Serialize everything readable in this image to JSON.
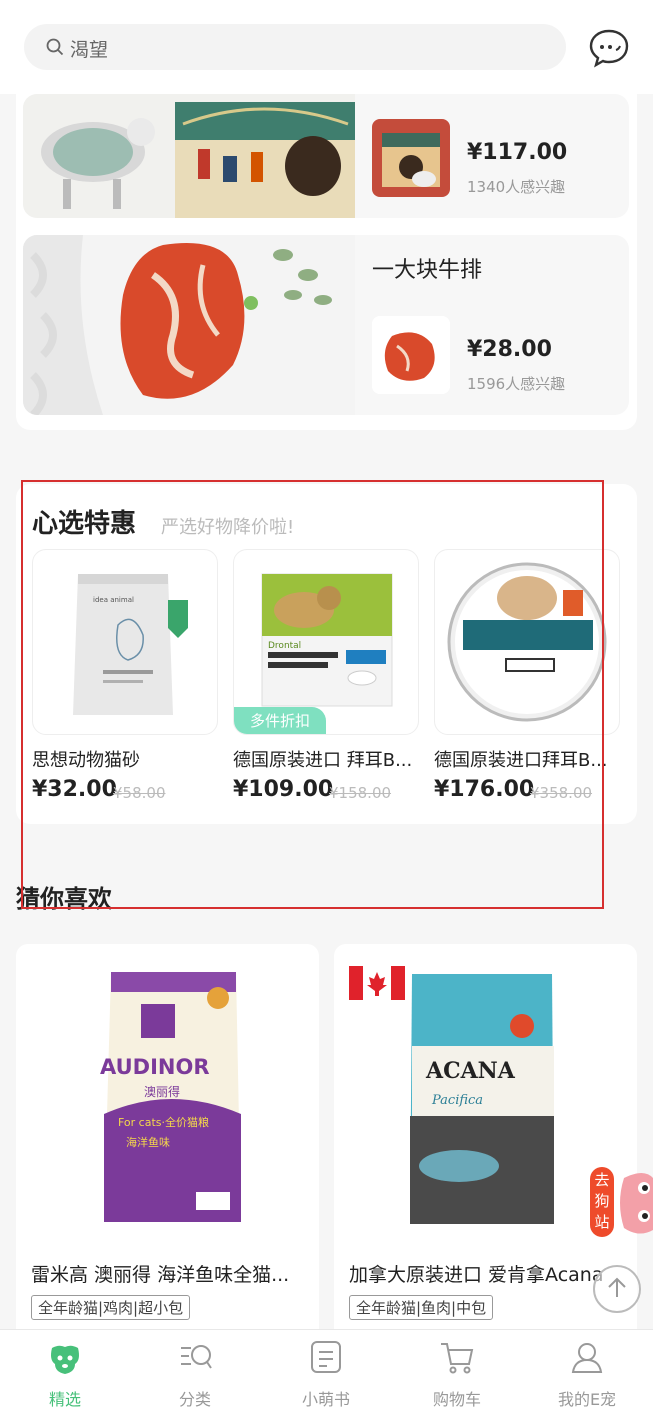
{
  "search": {
    "placeholder": "渴望"
  },
  "top_products": [
    {
      "title": "",
      "price": "¥117.00",
      "interest": "1340人感兴趣"
    },
    {
      "title": "一大块牛排",
      "price": "¥28.00",
      "interest": "1596人感兴趣"
    }
  ],
  "deals": {
    "title": "心选特惠",
    "subtitle": "严选好物降价啦!",
    "items": [
      {
        "name": "思想动物猫砂",
        "price": "¥32.00",
        "original": "¥58.00",
        "badge": ""
      },
      {
        "name": "德国原装进口 拜耳B...",
        "price": "¥109.00",
        "original": "¥158.00",
        "badge": "多件折扣"
      },
      {
        "name": "德国原装进口拜耳B...",
        "price": "¥176.00",
        "original": "¥358.00",
        "badge": ""
      }
    ]
  },
  "guess": {
    "title": "猜你喜欢",
    "items": [
      {
        "name": "雷米高 澳丽得 海洋鱼味全猫...",
        "tag": "全年龄猫|鸡肉|超小包",
        "brand": "AUDINOR",
        "brand_cn": "澳丽得",
        "for_cats": "For cats·全价猫粮",
        "flavor_cn": "海洋鱼味"
      },
      {
        "name": "加拿大原装进口 爱肯拿Acana",
        "tag": "全年龄猫|鱼肉|中包",
        "brand": "ACANA",
        "sub": "Pacifica"
      }
    ]
  },
  "float_dog": "去狗站",
  "tabs": [
    {
      "label": "精选",
      "icon": "dog-face-icon",
      "active": true
    },
    {
      "label": "分类",
      "icon": "category-icon",
      "active": false
    },
    {
      "label": "小萌书",
      "icon": "notebook-icon",
      "active": false
    },
    {
      "label": "购物车",
      "icon": "cart-icon",
      "active": false
    },
    {
      "label": "我的E宠",
      "icon": "profile-icon",
      "active": false
    }
  ],
  "colors": {
    "accent": "#47c07a",
    "badge": "#7fe0c0",
    "highlight_box": "#d62f2f",
    "float": "#ee4b2b"
  }
}
